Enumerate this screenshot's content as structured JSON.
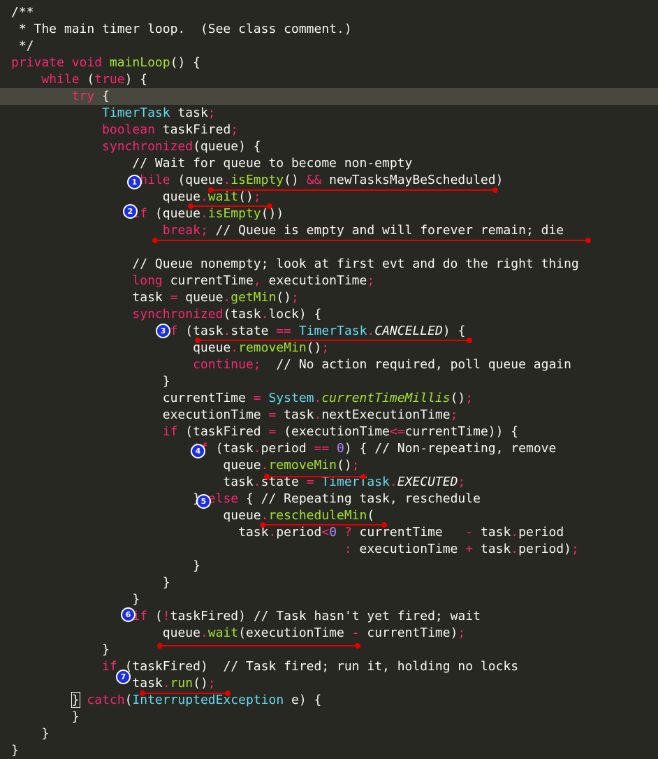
{
  "editor": {
    "theme_colors": {
      "background": "#272822",
      "current_line": "#49483e",
      "keyword": "#f92672",
      "type": "#66d9ef",
      "function": "#a6e22e",
      "number": "#ae81ff",
      "text": "#f8f8f2",
      "annotation_red": "#e00000",
      "badge_blue": "#1a2ee8"
    },
    "lines": [
      [
        [
          "c",
          "/**"
        ]
      ],
      [
        [
          "c",
          " * The main timer loop.  (See class comment.)"
        ]
      ],
      [
        [
          "c",
          " */"
        ]
      ],
      [
        [
          "k",
          "private"
        ],
        [
          "p",
          " "
        ],
        [
          "k",
          "void"
        ],
        [
          "p",
          " "
        ],
        [
          "f",
          "mainLoop"
        ],
        [
          "p",
          "() {"
        ]
      ],
      [
        [
          "p",
          "    "
        ],
        [
          "k",
          "while"
        ],
        [
          "p",
          " ("
        ],
        [
          "k",
          "true"
        ],
        [
          "p",
          ") {"
        ]
      ],
      [
        [
          "p",
          "        "
        ],
        [
          "k",
          "try"
        ],
        [
          "p",
          " {"
        ]
      ],
      [
        [
          "p",
          "            "
        ],
        [
          "t",
          "TimerTask"
        ],
        [
          "p",
          " task"
        ],
        [
          "o",
          ";"
        ]
      ],
      [
        [
          "p",
          "            "
        ],
        [
          "k",
          "boolean"
        ],
        [
          "p",
          " taskFired"
        ],
        [
          "o",
          ";"
        ]
      ],
      [
        [
          "p",
          "            "
        ],
        [
          "k",
          "synchronized"
        ],
        [
          "p",
          "(queue) {"
        ]
      ],
      [
        [
          "p",
          "                "
        ],
        [
          "c",
          "// Wait for queue to become non-empty"
        ]
      ],
      [
        [
          "p",
          "                "
        ],
        [
          "k",
          "while"
        ],
        [
          "p",
          " (queue"
        ],
        [
          "o",
          "."
        ],
        [
          "f",
          "isEmpty"
        ],
        [
          "p",
          "() "
        ],
        [
          "o",
          "&&"
        ],
        [
          "p",
          " newTasksMayBeScheduled)"
        ]
      ],
      [
        [
          "p",
          "                    queue"
        ],
        [
          "o",
          "."
        ],
        [
          "f",
          "wait"
        ],
        [
          "p",
          "()"
        ],
        [
          "o",
          ";"
        ]
      ],
      [
        [
          "p",
          "                "
        ],
        [
          "k",
          "if"
        ],
        [
          "p",
          " (queue"
        ],
        [
          "o",
          "."
        ],
        [
          "f",
          "isEmpty"
        ],
        [
          "p",
          "())"
        ]
      ],
      [
        [
          "p",
          "                    "
        ],
        [
          "k",
          "break"
        ],
        [
          "o",
          ";"
        ],
        [
          "p",
          " "
        ],
        [
          "c",
          "// Queue is empty and will forever remain; die"
        ]
      ],
      [
        [
          "p",
          ""
        ]
      ],
      [
        [
          "p",
          "                "
        ],
        [
          "c",
          "// Queue nonempty; look at first evt and do the right thing"
        ]
      ],
      [
        [
          "p",
          "                "
        ],
        [
          "k",
          "long"
        ],
        [
          "p",
          " currentTime"
        ],
        [
          "o",
          ","
        ],
        [
          "p",
          " executionTime"
        ],
        [
          "o",
          ";"
        ]
      ],
      [
        [
          "p",
          "                task "
        ],
        [
          "o",
          "="
        ],
        [
          "p",
          " queue"
        ],
        [
          "o",
          "."
        ],
        [
          "f",
          "getMin"
        ],
        [
          "p",
          "()"
        ],
        [
          "o",
          ";"
        ]
      ],
      [
        [
          "p",
          "                "
        ],
        [
          "k",
          "synchronized"
        ],
        [
          "p",
          "(task"
        ],
        [
          "o",
          "."
        ],
        [
          "p",
          "lock) {"
        ]
      ],
      [
        [
          "p",
          "                    "
        ],
        [
          "k",
          "if"
        ],
        [
          "p",
          " (task"
        ],
        [
          "o",
          "."
        ],
        [
          "p",
          "state "
        ],
        [
          "o",
          "=="
        ],
        [
          "p",
          " "
        ],
        [
          "t",
          "TimerTask"
        ],
        [
          "o",
          "."
        ],
        [
          "n",
          "CANCELLED"
        ],
        [
          "p",
          ") {"
        ]
      ],
      [
        [
          "p",
          "                        queue"
        ],
        [
          "o",
          "."
        ],
        [
          "f",
          "removeMin"
        ],
        [
          "p",
          "()"
        ],
        [
          "o",
          ";"
        ]
      ],
      [
        [
          "p",
          "                        "
        ],
        [
          "k",
          "continue"
        ],
        [
          "o",
          ";"
        ],
        [
          "p",
          "  "
        ],
        [
          "c",
          "// No action required, poll queue again"
        ]
      ],
      [
        [
          "p",
          "                    }"
        ]
      ],
      [
        [
          "p",
          "                    currentTime "
        ],
        [
          "o",
          "="
        ],
        [
          "p",
          " "
        ],
        [
          "t",
          "System"
        ],
        [
          "o",
          "."
        ],
        [
          "i",
          "currentTimeMillis"
        ],
        [
          "p",
          "()"
        ],
        [
          "o",
          ";"
        ]
      ],
      [
        [
          "p",
          "                    executionTime "
        ],
        [
          "o",
          "="
        ],
        [
          "p",
          " task"
        ],
        [
          "o",
          "."
        ],
        [
          "p",
          "nextExecutionTime"
        ],
        [
          "o",
          ";"
        ]
      ],
      [
        [
          "p",
          "                    "
        ],
        [
          "k",
          "if"
        ],
        [
          "p",
          " (taskFired "
        ],
        [
          "o",
          "="
        ],
        [
          "p",
          " (executionTime"
        ],
        [
          "o",
          "<="
        ],
        [
          "p",
          "currentTime)) {"
        ]
      ],
      [
        [
          "p",
          "                        "
        ],
        [
          "k",
          "if"
        ],
        [
          "p",
          " (task"
        ],
        [
          "o",
          "."
        ],
        [
          "p",
          "period "
        ],
        [
          "o",
          "=="
        ],
        [
          "p",
          " "
        ],
        [
          "m",
          "0"
        ],
        [
          "p",
          ") { "
        ],
        [
          "c",
          "// Non-repeating, remove"
        ]
      ],
      [
        [
          "p",
          "                            queue"
        ],
        [
          "o",
          "."
        ],
        [
          "f",
          "removeMin"
        ],
        [
          "p",
          "()"
        ],
        [
          "o",
          ";"
        ]
      ],
      [
        [
          "p",
          "                            task"
        ],
        [
          "o",
          "."
        ],
        [
          "p",
          "state "
        ],
        [
          "o",
          "="
        ],
        [
          "p",
          " "
        ],
        [
          "t",
          "TimerTask"
        ],
        [
          "o",
          "."
        ],
        [
          "n",
          "EXECUTED"
        ],
        [
          "o",
          ";"
        ]
      ],
      [
        [
          "p",
          "                        } "
        ],
        [
          "k",
          "else"
        ],
        [
          "p",
          " { "
        ],
        [
          "c",
          "// Repeating task, reschedule"
        ]
      ],
      [
        [
          "p",
          "                            queue"
        ],
        [
          "o",
          "."
        ],
        [
          "f",
          "rescheduleMin"
        ],
        [
          "p",
          "("
        ]
      ],
      [
        [
          "p",
          "                              task"
        ],
        [
          "o",
          "."
        ],
        [
          "p",
          "period"
        ],
        [
          "o",
          "<"
        ],
        [
          "m",
          "0"
        ],
        [
          "p",
          " "
        ],
        [
          "o",
          "?"
        ],
        [
          "p",
          " currentTime   "
        ],
        [
          "o",
          "-"
        ],
        [
          "p",
          " task"
        ],
        [
          "o",
          "."
        ],
        [
          "p",
          "period"
        ]
      ],
      [
        [
          "p",
          "                                            "
        ],
        [
          "o",
          ":"
        ],
        [
          "p",
          " executionTime "
        ],
        [
          "o",
          "+"
        ],
        [
          "p",
          " task"
        ],
        [
          "o",
          "."
        ],
        [
          "p",
          "period)"
        ],
        [
          "o",
          ";"
        ]
      ],
      [
        [
          "p",
          "                        }"
        ]
      ],
      [
        [
          "p",
          "                    }"
        ]
      ],
      [
        [
          "p",
          "                }"
        ]
      ],
      [
        [
          "p",
          "                "
        ],
        [
          "k",
          "if"
        ],
        [
          "p",
          " ("
        ],
        [
          "o",
          "!"
        ],
        [
          "p",
          "taskFired) "
        ],
        [
          "c",
          "// Task hasn't yet fired; wait"
        ]
      ],
      [
        [
          "p",
          "                    queue"
        ],
        [
          "o",
          "."
        ],
        [
          "f",
          "wait"
        ],
        [
          "p",
          "(executionTime "
        ],
        [
          "o",
          "-"
        ],
        [
          "p",
          " currentTime)"
        ],
        [
          "o",
          ";"
        ]
      ],
      [
        [
          "p",
          "            }"
        ]
      ],
      [
        [
          "p",
          "            "
        ],
        [
          "k",
          "if"
        ],
        [
          "p",
          " (taskFired)  "
        ],
        [
          "c",
          "// Task fired; run it, holding no locks"
        ]
      ],
      [
        [
          "p",
          "                task"
        ],
        [
          "o",
          "."
        ],
        [
          "f",
          "run"
        ],
        [
          "p",
          "()"
        ],
        [
          "o",
          ";"
        ]
      ],
      [
        [
          "p",
          "        "
        ],
        [
          "x",
          "}"
        ],
        [
          "p",
          " "
        ],
        [
          "k",
          "catch"
        ],
        [
          "p",
          "("
        ],
        [
          "t",
          "InterruptedException"
        ],
        [
          "p",
          " e) {"
        ]
      ],
      [
        [
          "p",
          "        }"
        ]
      ],
      [
        [
          "p",
          "    }"
        ]
      ],
      [
        [
          "p",
          "}"
        ]
      ]
    ],
    "current_line_index": 5,
    "badges": [
      "1",
      "2",
      "3",
      "4",
      "5",
      "6",
      "7"
    ]
  }
}
